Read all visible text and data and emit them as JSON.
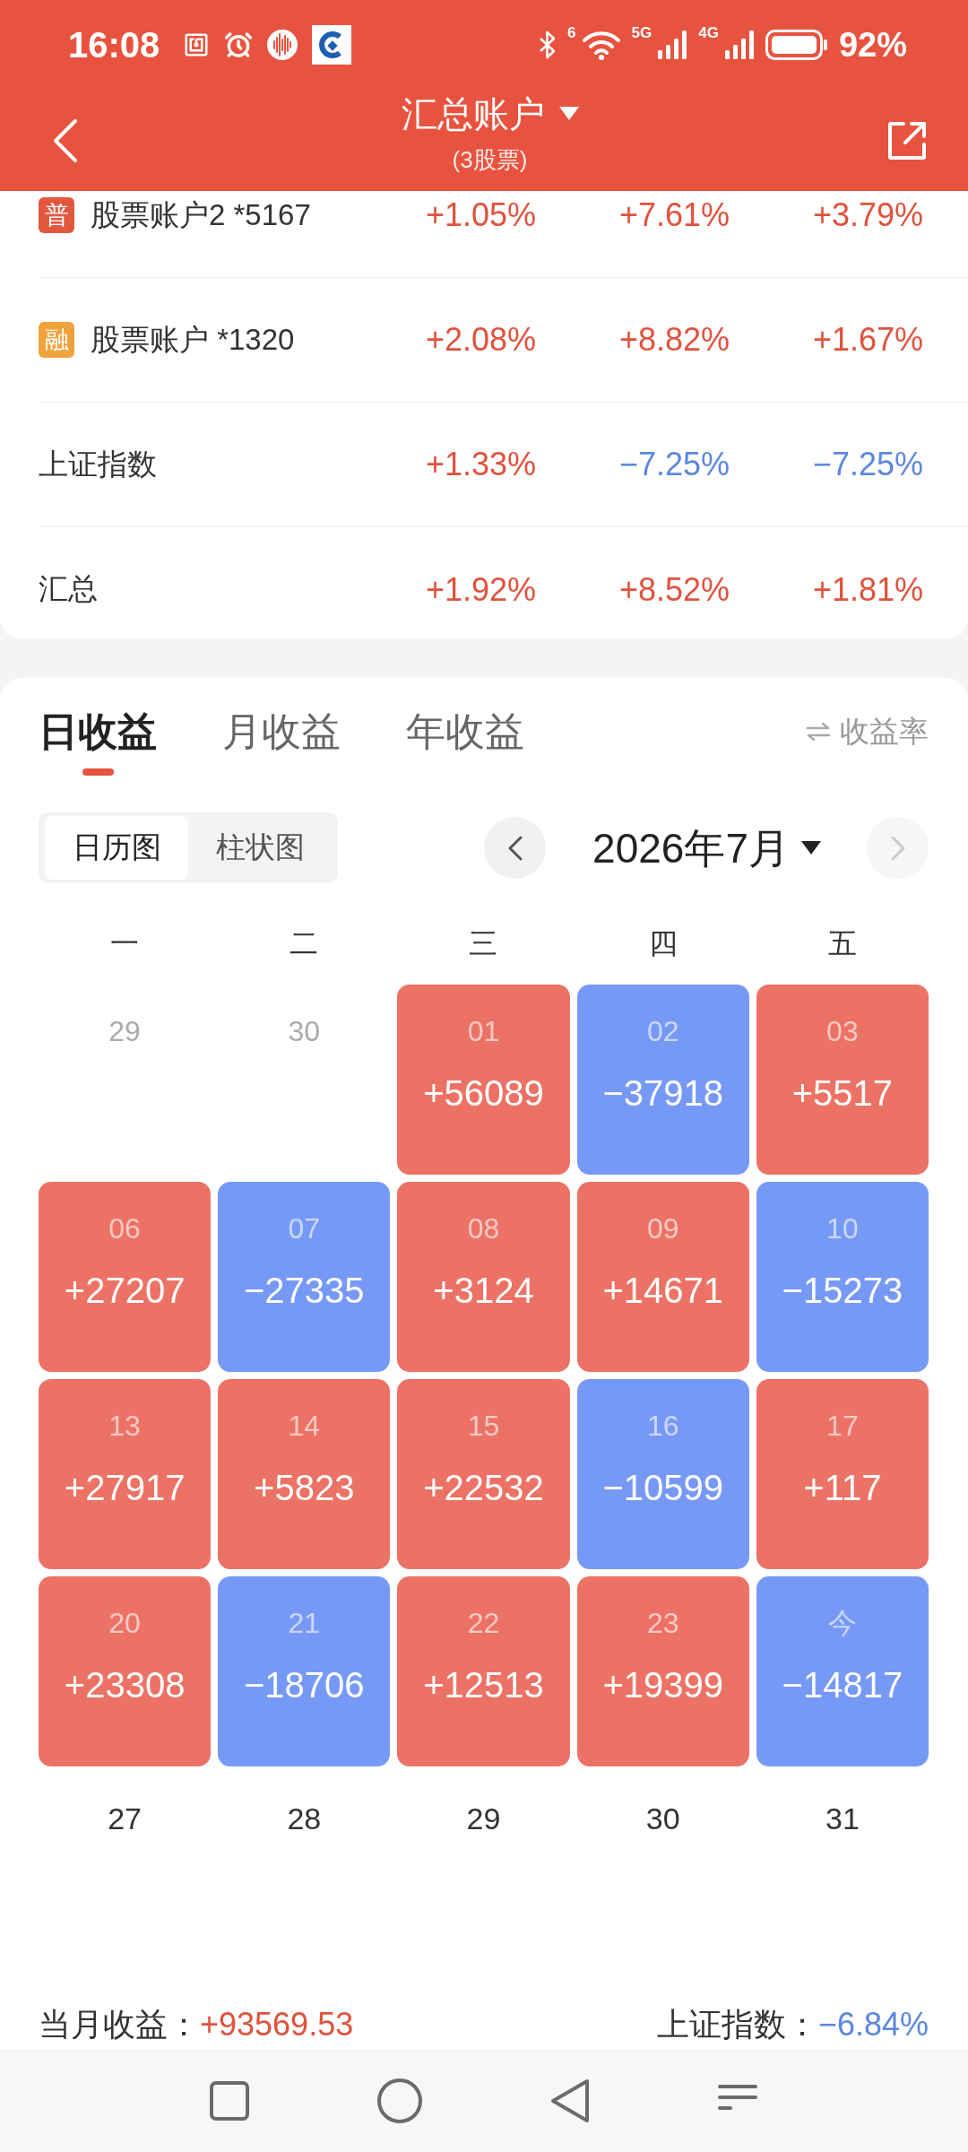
{
  "status_bar": {
    "time": "16:08",
    "wifi_label": "6",
    "networks": [
      {
        "label": "5G"
      },
      {
        "label": "4G"
      }
    ],
    "battery": "92%"
  },
  "header": {
    "title": "汇总账户",
    "subtitle": "(3股票)"
  },
  "accounts": [
    {
      "badge": {
        "text": "普",
        "color": "#e4573f"
      },
      "name": "股票账户2 *5167",
      "values": [
        {
          "text": "+1.05%",
          "negative": false
        },
        {
          "text": "+7.61%",
          "negative": false
        },
        {
          "text": "+3.79%",
          "negative": false
        }
      ]
    },
    {
      "badge": {
        "text": "融",
        "color": "#f0a33c"
      },
      "name": "股票账户 *1320",
      "values": [
        {
          "text": "+2.08%",
          "negative": false
        },
        {
          "text": "+8.82%",
          "negative": false
        },
        {
          "text": "+1.67%",
          "negative": false
        }
      ]
    },
    {
      "name": "上证指数",
      "values": [
        {
          "text": "+1.33%",
          "negative": false
        },
        {
          "text": "−7.25%",
          "negative": true
        },
        {
          "text": "−7.25%",
          "negative": true
        }
      ]
    },
    {
      "name": "汇总",
      "values": [
        {
          "text": "+1.92%",
          "negative": false
        },
        {
          "text": "+8.52%",
          "negative": false
        },
        {
          "text": "+1.81%",
          "negative": false
        }
      ]
    }
  ],
  "tabs": [
    {
      "label": "日收益",
      "selected": true
    },
    {
      "label": "月收益",
      "selected": false
    },
    {
      "label": "年收益",
      "selected": false
    }
  ],
  "rate_toggle": {
    "label": "收益率"
  },
  "view_switch": [
    {
      "label": "日历图",
      "selected": true
    },
    {
      "label": "柱状图",
      "selected": false
    }
  ],
  "month_nav": {
    "title": "2026年7月",
    "prev": {
      "disabled": false
    },
    "next": {
      "disabled": true
    }
  },
  "weekdays": [
    "一",
    "二",
    "三",
    "四",
    "五"
  ],
  "calendar": [
    {
      "day": "29",
      "kind": "outside"
    },
    {
      "day": "30",
      "kind": "outside"
    },
    {
      "day": "01",
      "amount": "+56089",
      "kind": "gain"
    },
    {
      "day": "02",
      "amount": "−37918",
      "kind": "loss"
    },
    {
      "day": "03",
      "amount": "+5517",
      "kind": "gain"
    },
    {
      "day": "06",
      "amount": "+27207",
      "kind": "gain"
    },
    {
      "day": "07",
      "amount": "−27335",
      "kind": "loss"
    },
    {
      "day": "08",
      "amount": "+3124",
      "kind": "gain"
    },
    {
      "day": "09",
      "amount": "+14671",
      "kind": "gain"
    },
    {
      "day": "10",
      "amount": "−15273",
      "kind": "loss"
    },
    {
      "day": "13",
      "amount": "+27917",
      "kind": "gain"
    },
    {
      "day": "14",
      "amount": "+5823",
      "kind": "gain"
    },
    {
      "day": "15",
      "amount": "+22532",
      "kind": "gain"
    },
    {
      "day": "16",
      "amount": "−10599",
      "kind": "loss"
    },
    {
      "day": "17",
      "amount": "+117",
      "kind": "gain"
    },
    {
      "day": "20",
      "amount": "+23308",
      "kind": "gain"
    },
    {
      "day": "21",
      "amount": "−18706",
      "kind": "loss"
    },
    {
      "day": "22",
      "amount": "+12513",
      "kind": "gain"
    },
    {
      "day": "23",
      "amount": "+19399",
      "kind": "gain"
    },
    {
      "day": "今",
      "amount": "−14817",
      "kind": "loss"
    },
    {
      "day": "27",
      "kind": "future"
    },
    {
      "day": "28",
      "kind": "future"
    },
    {
      "day": "29",
      "kind": "future"
    },
    {
      "day": "30",
      "kind": "future"
    },
    {
      "day": "31",
      "kind": "future"
    }
  ],
  "summary": [
    {
      "label": "当月收益：",
      "value": "+93569.53",
      "negative": false
    },
    {
      "label": "上证指数：",
      "value": "−6.84%",
      "negative": true
    }
  ]
}
